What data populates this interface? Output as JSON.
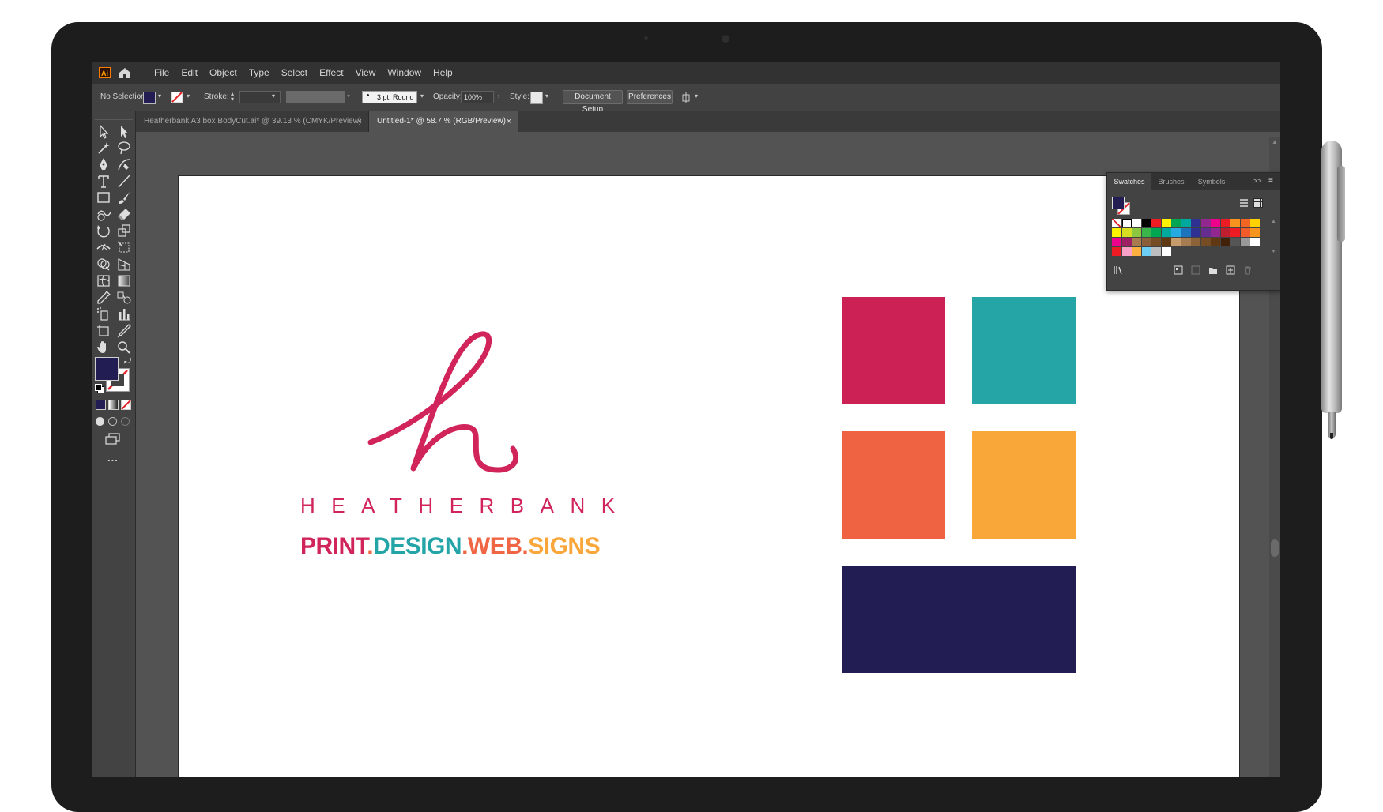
{
  "app": {
    "logo": "Ai"
  },
  "menu": [
    "File",
    "Edit",
    "Object",
    "Type",
    "Select",
    "Effect",
    "View",
    "Window",
    "Help"
  ],
  "control_bar": {
    "selection": "No Selection",
    "stroke_label": "Stroke:",
    "brush": "3 pt. Round",
    "opacity_label": "Opacity:",
    "opacity_value": "100%",
    "style_label": "Style:",
    "document_setup": "Document Setup",
    "preferences": "Preferences"
  },
  "tabs": [
    {
      "label": "Heatherbank A3 box BodyCut.ai* @ 39.13 % (CMYK/Preview)",
      "close": "×",
      "active": false
    },
    {
      "label": "Untitled-1* @ 58.7 % (RGB/Preview)",
      "close": "×",
      "active": true
    }
  ],
  "toolbar": {
    "more": "..."
  },
  "panel": {
    "tabs": [
      "Swatches",
      "Brushes",
      "Symbols"
    ],
    "expand": ">>",
    "menu": "≡",
    "swatch_rows": [
      [
        "none",
        "reg",
        "#ffffff",
        "#000000",
        "#ed1c24",
        "#fff200",
        "#00a651",
        "#00a99d",
        "#2e3192",
        "#92278f",
        "#ec008c",
        "#ed1c24",
        "#f7941d",
        "#f26522",
        "#ffd100"
      ],
      [
        "#fff200",
        "#d7df23",
        "#8dc63f",
        "#39b54a",
        "#00a651",
        "#00a99d",
        "#27aae1",
        "#1c75bc",
        "#2e3192",
        "#662d91",
        "#92278f",
        "#be1e2d",
        "#ed1c24",
        "#f15a29",
        "#f7941d"
      ],
      [
        "#ec008c",
        "#9e1f63",
        "#a97c50",
        "#8b5e3c",
        "#754c24",
        "#603913",
        "#c69c6d",
        "#a67c52",
        "#8c6239",
        "#754c24",
        "#603813",
        "#42210b",
        "#555555",
        "#999999",
        "#ffffff"
      ],
      [
        "#ed1c24",
        "#f9a0c6",
        "#fbb040",
        "#6dcff6",
        "#bcbec0",
        "#ffffff"
      ]
    ]
  },
  "artwork": {
    "brand": "HEATHERBANK",
    "tagline": [
      {
        "text": "PRINT",
        "color": "#d0245a"
      },
      {
        "text": ".",
        "color": "#f06543"
      },
      {
        "text": "DESIGN",
        "color": "#23a5a8"
      },
      {
        "text": ".",
        "color": "#f06543"
      },
      {
        "text": "WEB",
        "color": "#f06543"
      },
      {
        "text": ".",
        "color": "#f06543"
      },
      {
        "text": "SIGNS",
        "color": "#f9a73a"
      }
    ],
    "logo_color": "#d0245a",
    "brand_color": "#d0245a",
    "palette": [
      {
        "name": "pink",
        "color": "#cc2154"
      },
      {
        "name": "teal",
        "color": "#25a5a6"
      },
      {
        "name": "orange",
        "color": "#ef6343"
      },
      {
        "name": "yellow",
        "color": "#faa73a"
      },
      {
        "name": "navy",
        "color": "#221d52"
      }
    ]
  },
  "colors": {
    "fill": "#221d52"
  }
}
